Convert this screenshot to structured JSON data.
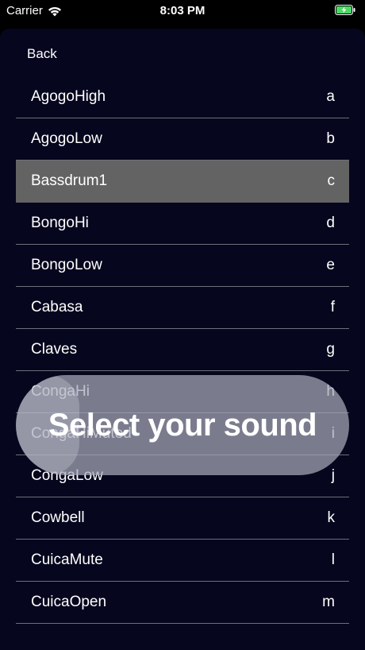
{
  "status_bar": {
    "carrier": "Carrier",
    "time": "8:03 PM",
    "wifi_icon": "wifi-icon",
    "battery_icon": "battery-charging-icon",
    "battery_color": "#4cd964"
  },
  "header": {
    "back_label": "Back"
  },
  "sounds": [
    {
      "name": "AgogoHigh",
      "key": "a"
    },
    {
      "name": "AgogoLow",
      "key": "b"
    },
    {
      "name": "Bassdrum1",
      "key": "c"
    },
    {
      "name": "BongoHi",
      "key": "d"
    },
    {
      "name": "BongoLow",
      "key": "e"
    },
    {
      "name": "Cabasa",
      "key": "f"
    },
    {
      "name": "Claves",
      "key": "g"
    },
    {
      "name": "CongaHi",
      "key": "h"
    },
    {
      "name": "CongaHiMuted",
      "key": "i"
    },
    {
      "name": "CongaLow",
      "key": "j"
    },
    {
      "name": "Cowbell",
      "key": "k"
    },
    {
      "name": "CuicaMute",
      "key": "l"
    },
    {
      "name": "CuicaOpen",
      "key": "m"
    }
  ],
  "selected_sound": "Bassdrum1",
  "toast": {
    "message": "Select your sound"
  },
  "colors": {
    "background": "#06061e",
    "selected_row": "#636363",
    "separator": "#6e6e7a"
  }
}
